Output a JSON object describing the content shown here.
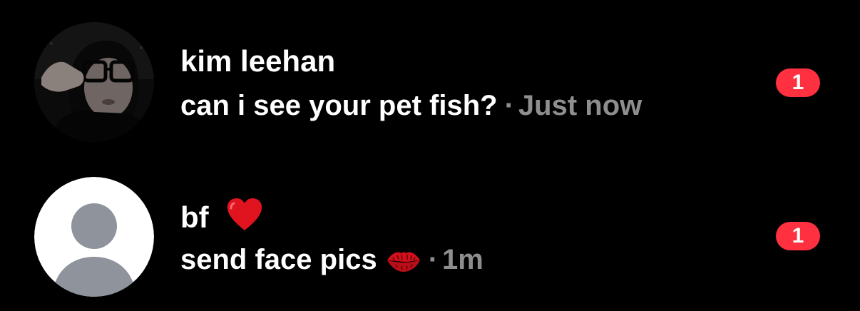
{
  "colors": {
    "background": "#000000",
    "text_primary": "#ffffff",
    "text_secondary": "#8e8e8e",
    "badge": "#ff3040",
    "default_avatar_bg": "#ffffff",
    "default_avatar_silhouette": "#8e939c"
  },
  "conversations": [
    {
      "name": "kim leehan",
      "name_emoji": "",
      "avatar": "profile-photo",
      "message": "can i see your pet fish?",
      "message_emoji": "",
      "separator": "·",
      "time": "Just now",
      "unread_count": "1"
    },
    {
      "name": "bf",
      "name_emoji": "red-heart-icon",
      "avatar": "default-user-icon",
      "message": "send face pics",
      "message_emoji": "kiss-mark-icon",
      "separator": "·",
      "time": "1m",
      "unread_count": "1"
    }
  ]
}
